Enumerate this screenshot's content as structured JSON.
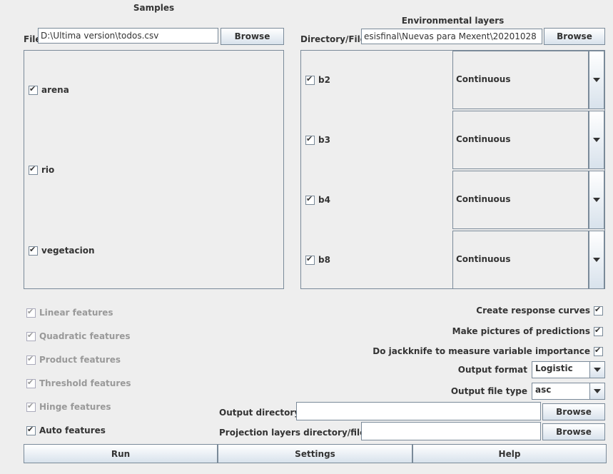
{
  "samples": {
    "heading": "Samples",
    "file_label": "File",
    "file_value": "D:\\Ultima version\\todos.csv",
    "browse_label": "Browse",
    "species": [
      {
        "name": "arena",
        "checked": true
      },
      {
        "name": "rio",
        "checked": true
      },
      {
        "name": "vegetacion",
        "checked": true
      }
    ]
  },
  "env": {
    "heading": "Environmental layers",
    "dir_label": "Directory/File",
    "dir_value": "esisfinal\\Nuevas para Mexent\\20201028",
    "browse_label": "Browse",
    "layers": [
      {
        "name": "b2",
        "type": "Continuous"
      },
      {
        "name": "b3",
        "type": "Continuous"
      },
      {
        "name": "b4",
        "type": "Continuous"
      },
      {
        "name": "b8",
        "type": "Continuous"
      }
    ]
  },
  "features": [
    {
      "label": "Linear features",
      "enabled": false
    },
    {
      "label": "Quadratic features",
      "enabled": false
    },
    {
      "label": "Product features",
      "enabled": false
    },
    {
      "label": "Threshold features",
      "enabled": false
    },
    {
      "label": "Hinge features",
      "enabled": false
    },
    {
      "label": "Auto features",
      "enabled": true
    }
  ],
  "options": {
    "response_curves": "Create response curves",
    "pictures": "Make pictures of predictions",
    "jackknife": "Do jackknife to measure variable importance",
    "output_format_label": "Output format",
    "output_format_value": "Logistic",
    "output_type_label": "Output file type",
    "output_type_value": "asc"
  },
  "output": {
    "dir_label": "Output directory",
    "dir_value": "",
    "proj_label": "Projection layers directory/file",
    "proj_value": "",
    "browse_label": "Browse"
  },
  "actions": {
    "run": "Run",
    "settings": "Settings",
    "help": "Help"
  }
}
